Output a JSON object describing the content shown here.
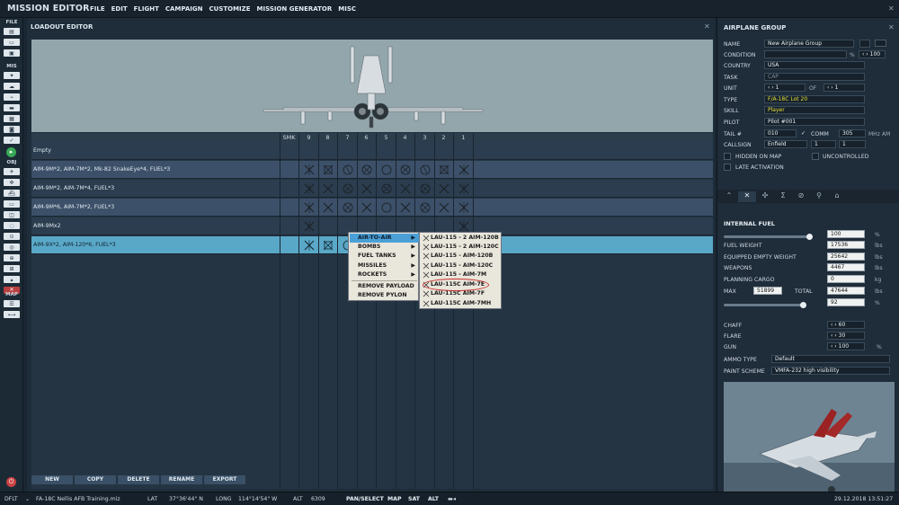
{
  "app": {
    "title": "MISSION EDITOR"
  },
  "menu": [
    "FILE",
    "EDIT",
    "FLIGHT",
    "CAMPAIGN",
    "CUSTOMIZE",
    "MISSION GENERATOR",
    "MISC"
  ],
  "left_toolbar": {
    "file_label": "FILE",
    "mis_label": "MIS",
    "obj_label": "OBJ",
    "map_label": "MAP"
  },
  "loadout_editor": {
    "title": "LOADOUT EDITOR",
    "columns": [
      "SMK",
      "9",
      "8",
      "7",
      "6",
      "5",
      "4",
      "3",
      "2",
      "1"
    ],
    "rows": [
      {
        "label": "Empty"
      },
      {
        "label": "AIM-9M*2, AIM-7M*2, Mk-82 SnakeEye*4, FUEL*3"
      },
      {
        "label": "AIM-9M*2, AIM-7M*4, FUEL*3"
      },
      {
        "label": "AIM-9M*6, AIM-7M*2, FUEL*3"
      },
      {
        "label": "AIM-9Mx2"
      },
      {
        "label": "AIM-9X*2, AIM-120*6, FUEL*3"
      }
    ],
    "selected_row": 5,
    "buttons": [
      "NEW",
      "COPY",
      "DELETE",
      "RENAME",
      "EXPORT"
    ]
  },
  "context_menu": {
    "items": [
      "AIR-TO-AIR",
      "BOMBS",
      "FUEL TANKS",
      "MISSILES",
      "ROCKETS"
    ],
    "actions": [
      "REMOVE PAYLOAD",
      "REMOVE PYLON"
    ],
    "active": "AIR-TO-AIR",
    "submenu": [
      "LAU-115 - 2 AIM-120B",
      "LAU-115 - 2 AIM-120C",
      "LAU-115 - AIM-120B",
      "LAU-115 - AIM-120C",
      "LAU-115 - AIM-7M",
      "LAU-115C AIM-7E",
      "LAU-115C AIM-7F",
      "LAU-115C AIM-7MH"
    ]
  },
  "group": {
    "title": "AIRPLANE GROUP",
    "name_label": "NAME",
    "name": "New Airplane Group",
    "condition_label": "CONDITION",
    "condition_unit": "%",
    "condition_value": "100",
    "country_label": "COUNTRY",
    "country": "USA",
    "task_label": "TASK",
    "task": "CAP",
    "unit_label": "UNIT",
    "unit_value": "1",
    "unit_of": "OF",
    "unit_total": "1",
    "type_label": "TYPE",
    "type": "F/A-18C Lot 20",
    "skill_label": "SKILL",
    "skill": "Player",
    "pilot_label": "PILOT",
    "pilot": "Pilot #001",
    "tail_label": "TAIL #",
    "tail": "010",
    "comm_label": "COMM",
    "comm": "305",
    "comm_unit": "MHz",
    "comm_mod": "AM",
    "callsign_label": "CALLSIGN",
    "callsign": "Enfield",
    "callsign_1": "1",
    "callsign_2": "1",
    "hidden_label": "HIDDEN ON MAP",
    "uncontrolled_label": "UNCONTROLLED",
    "late_label": "LATE ACTIVATION",
    "fuel_section": "INTERNAL FUEL",
    "fuel_pct": "100",
    "fuel_pct_unit": "%",
    "fuel_weight_label": "FUEL WEIGHT",
    "fuel_weight": "17536",
    "empty_label": "EQUIPPED EMPTY WEIGHT",
    "empty": "25642",
    "weapons_label": "WEAPONS",
    "weapons": "4467",
    "cargo_label": "PLANNING CARGO",
    "cargo": "0",
    "max_label": "MAX",
    "max": "51899",
    "total_label": "TOTAL",
    "total": "47644",
    "pct2": "92",
    "pct2_unit": "%",
    "lbs": "lbs",
    "kg": "kg",
    "chaff_label": "CHAFF",
    "chaff": "60",
    "flare_label": "FLARE",
    "flare": "30",
    "gun_label": "GUN",
    "gun": "100",
    "gun_unit": "%",
    "ammo_label": "AMMO TYPE",
    "ammo": "Default",
    "paint_label": "PAINT SCHEME",
    "paint": "VMFA-232 high visibility"
  },
  "status": {
    "mode": "DFLT",
    "file": "FA-18C Nellis AFB Training.miz",
    "lat_label": "LAT",
    "lat": "37°36'44\" N",
    "long_label": "LONG",
    "long": "114°14'54\" W",
    "alt_label": "ALT",
    "alt": "6309",
    "pan": "PAN/SELECT",
    "map": "MAP",
    "sat": "SAT",
    "alt_btn": "ALT",
    "datetime": "29.12.2018 13:51:27"
  }
}
